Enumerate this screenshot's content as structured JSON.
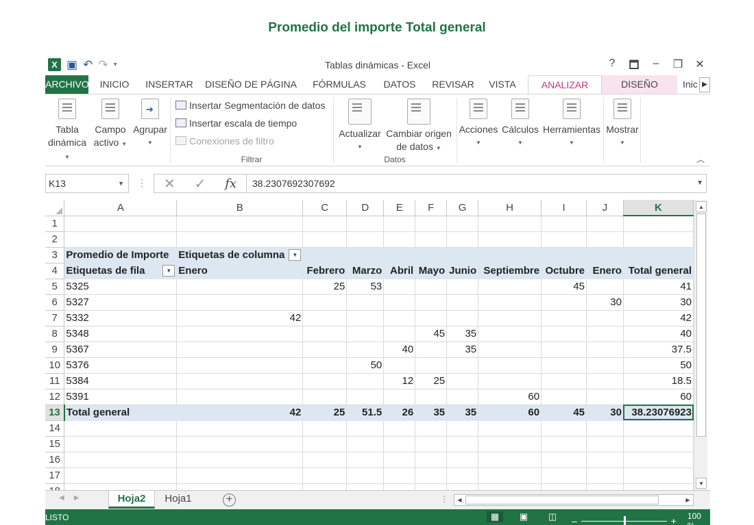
{
  "page_heading": "Promedio del importe Total general",
  "window": {
    "title": "Tablas dinámicas - Excel",
    "ctrl_help": "?",
    "ctrl_ribbon": "🗖",
    "ctrl_min": "–",
    "ctrl_restore": "❐",
    "ctrl_close": "✕"
  },
  "qat": {
    "undo": "↶",
    "redo": "↷",
    "customize": "▾"
  },
  "tabs": {
    "file": "ARCHIVO",
    "home": "INICIO",
    "insert": "INSERTAR",
    "layout": "DISEÑO DE PÁGINA",
    "formulas": "FÓRMULAS",
    "data": "DATOS",
    "review": "REVISAR",
    "view": "VISTA",
    "analyze": "ANALIZAR",
    "design": "DISEÑO",
    "overflow": "Inic"
  },
  "ribbon": {
    "pivot_table": [
      "Tabla",
      "dinámica"
    ],
    "active_field": [
      "Campo",
      "activo"
    ],
    "group": "Agrupar",
    "insert_slicer": "Insertar Segmentación de datos",
    "insert_timeline": "Insertar escala de tiempo",
    "filter_connections": "Conexiones de filtro",
    "group_filter": "Filtrar",
    "refresh": "Actualizar",
    "change_source": [
      "Cambiar origen",
      "de datos"
    ],
    "group_data": "Datos",
    "actions": "Acciones",
    "calculations": "Cálculos",
    "tools": "Herramientas",
    "show": "Mostrar"
  },
  "formula_bar": {
    "name_box": "K13",
    "value": "38.2307692307692"
  },
  "columns": [
    "A",
    "B",
    "C",
    "D",
    "E",
    "F",
    "G",
    "H",
    "I",
    "J",
    "K"
  ],
  "pivot": {
    "row3": {
      "a": "Promedio de Importe",
      "b": "Etiquetas de columna"
    },
    "row4": [
      "Etiquetas de fila",
      "Enero",
      "Febrero",
      "Marzo",
      "Abril",
      "Mayo",
      "Junio",
      "Septiembre",
      "Octubre",
      "Enero",
      "Total general"
    ],
    "rows": [
      {
        "n": "5",
        "cells": [
          "5325",
          "",
          "25",
          "53",
          "",
          "",
          "",
          "",
          "45",
          "",
          "41"
        ]
      },
      {
        "n": "6",
        "cells": [
          "5327",
          "",
          "",
          "",
          "",
          "",
          "",
          "",
          "",
          "30",
          "30"
        ]
      },
      {
        "n": "7",
        "cells": [
          "5332",
          "42",
          "",
          "",
          "",
          "",
          "",
          "",
          "",
          "",
          "42"
        ]
      },
      {
        "n": "8",
        "cells": [
          "5348",
          "",
          "",
          "",
          "",
          "45",
          "35",
          "",
          "",
          "",
          "40"
        ]
      },
      {
        "n": "9",
        "cells": [
          "5367",
          "",
          "",
          "",
          "40",
          "",
          "35",
          "",
          "",
          "",
          "37.5"
        ]
      },
      {
        "n": "10",
        "cells": [
          "5376",
          "",
          "",
          "50",
          "",
          "",
          "",
          "",
          "",
          "",
          "50"
        ]
      },
      {
        "n": "11",
        "cells": [
          "5384",
          "",
          "",
          "",
          "12",
          "25",
          "",
          "",
          "",
          "",
          "18.5"
        ]
      },
      {
        "n": "12",
        "cells": [
          "5391",
          "",
          "",
          "",
          "",
          "",
          "",
          "60",
          "",
          "",
          "60"
        ]
      }
    ],
    "total": [
      "Total general",
      "42",
      "25",
      "51.5",
      "26",
      "35",
      "35",
      "60",
      "45",
      "30",
      "38.23076923"
    ]
  },
  "sheets": {
    "active": "Hoja2",
    "other": "Hoja1",
    "add": "+"
  },
  "status": {
    "ready": "LISTO",
    "zoom": "100 %",
    "zoom_minus": "–",
    "zoom_plus": "+"
  }
}
